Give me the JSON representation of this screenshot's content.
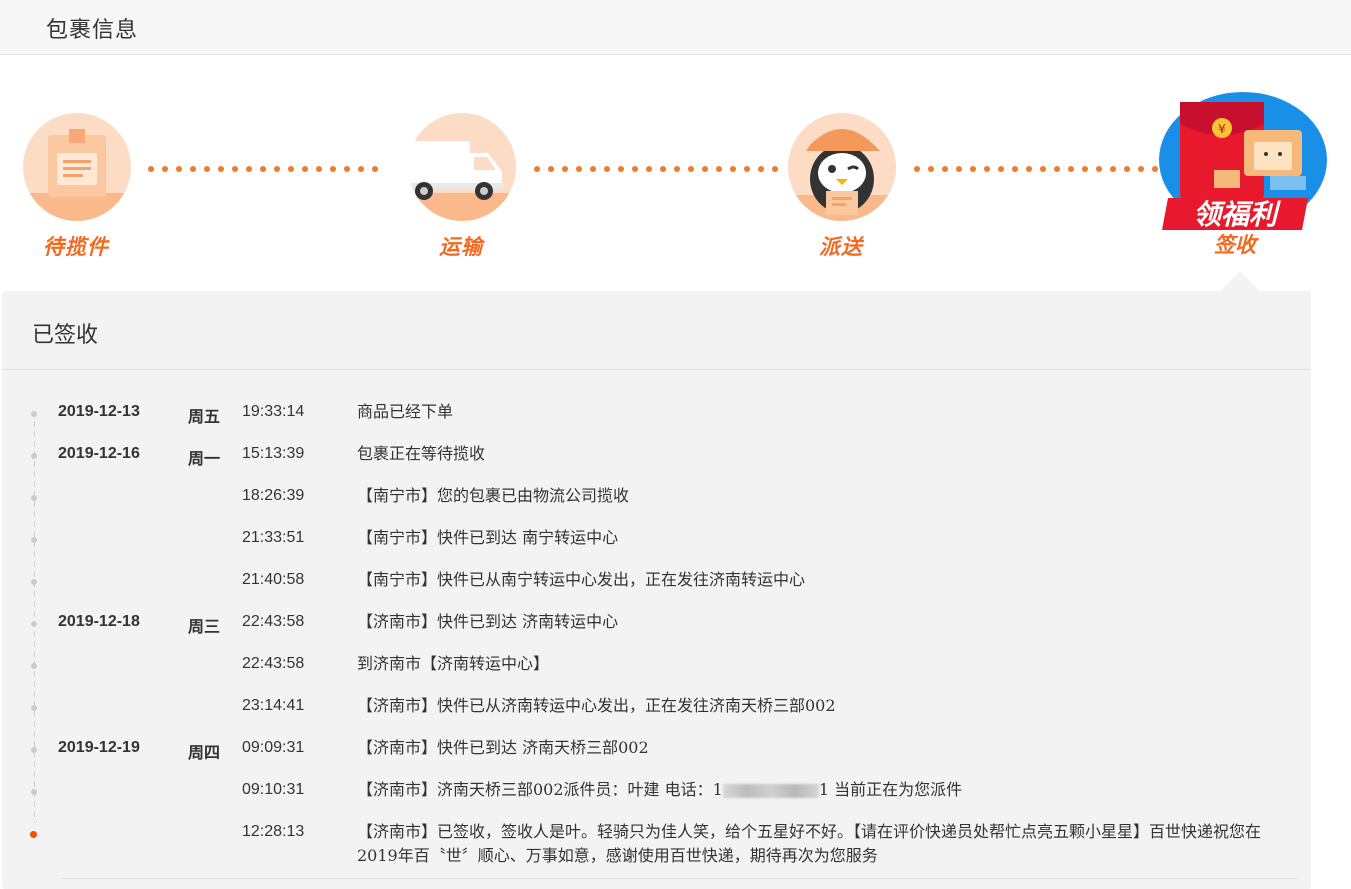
{
  "header": {
    "title": "包裹信息"
  },
  "progress": {
    "stages": [
      {
        "label": "待揽件",
        "icon": "package-icon"
      },
      {
        "label": "运输",
        "icon": "truck-icon"
      },
      {
        "label": "派送",
        "icon": "courier-icon"
      },
      {
        "label": "签收",
        "icon": "red-envelope-icon"
      }
    ],
    "promo": {
      "text": "领福利"
    }
  },
  "panel": {
    "status": "已签收",
    "events": [
      {
        "date": "2019-12-13",
        "week": "周五",
        "time": "19:33:14",
        "msg": "商品已经下单"
      },
      {
        "date": "2019-12-16",
        "week": "周一",
        "time": "15:13:39",
        "msg": "包裹正在等待揽收"
      },
      {
        "date": "",
        "week": "",
        "time": "18:26:39",
        "msg": "【南宁市】您的包裹已由物流公司揽收"
      },
      {
        "date": "",
        "week": "",
        "time": "21:33:51",
        "msg": "【南宁市】快件已到达 南宁转运中心"
      },
      {
        "date": "",
        "week": "",
        "time": "21:40:58",
        "msg": "【南宁市】快件已从南宁转运中心发出，正在发往济南转运中心"
      },
      {
        "date": "2019-12-18",
        "week": "周三",
        "time": "22:43:58",
        "msg": "【济南市】快件已到达 济南转运中心"
      },
      {
        "date": "",
        "week": "",
        "time": "22:43:58",
        "msg": "到济南市【济南转运中心】"
      },
      {
        "date": "",
        "week": "",
        "time": "23:14:41",
        "msg": "【济南市】快件已从济南转运中心发出，正在发往济南天桥三部002"
      },
      {
        "date": "2019-12-19",
        "week": "周四",
        "time": "09:09:31",
        "msg": "【济南市】快件已到达 济南天桥三部002"
      },
      {
        "date": "",
        "week": "",
        "time": "09:10:31",
        "msg_pre": "【济南市】济南天桥三部002派件员：叶建 电话：1",
        "msg_post": "1 当前正在为您派件"
      },
      {
        "date": "",
        "week": "",
        "time": "12:28:13",
        "msg": "【济南市】已签收，签收人是叶。轻骑只为佳人笑，给个五星好不好。【请在评价快递员处帮忙点亮五颗小星星】百世快递祝您在2019年百〝世〞顺心、万事如意，感谢使用百世快递，期待再次为您服务"
      }
    ]
  },
  "colors": {
    "accent": "#f26a21",
    "active_dot": "#ff4a00",
    "panel_bg": "#f3f3f3"
  }
}
